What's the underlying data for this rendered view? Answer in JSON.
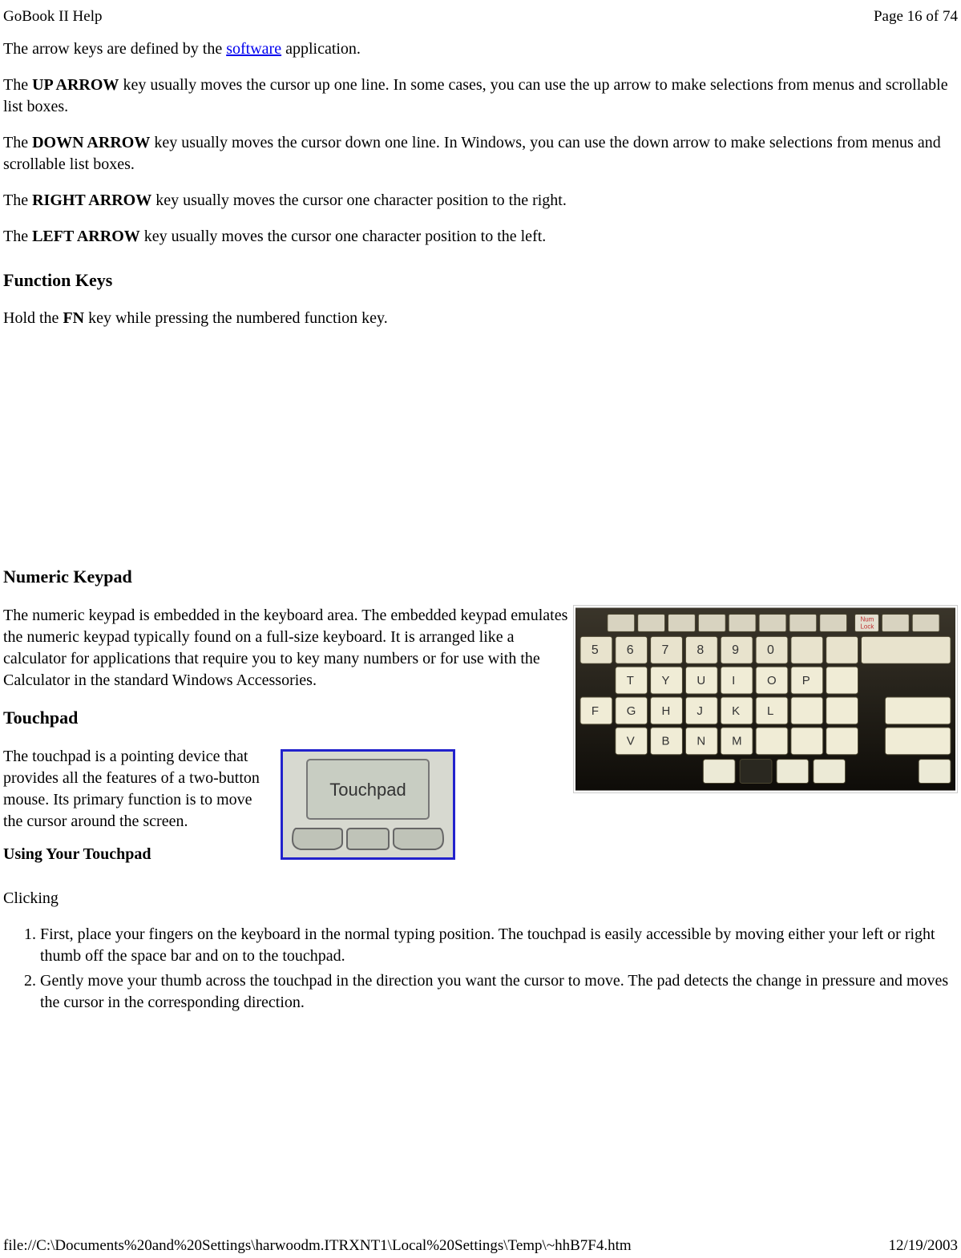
{
  "header": {
    "title": "GoBook II Help",
    "page_label": "Page 16 of 74"
  },
  "body": {
    "arrow_intro_pre": "The arrow keys are defined by the ",
    "software_link": "software",
    "arrow_intro_post": " application.",
    "up_arrow_label": "UP ARROW",
    "up_arrow_text_pre": "The ",
    "up_arrow_text_post": " key usually moves the cursor up one line. In some cases, you can use the up arrow to make selections from menus and scrollable list boxes.",
    "down_arrow_label": "DOWN ARROW",
    "down_arrow_text_pre": "The ",
    "down_arrow_text_post": " key usually moves the cursor down one line. In Windows, you can use the down arrow to make selections from menus and scrollable list boxes.",
    "right_arrow_label": "RIGHT ARROW",
    "right_arrow_text_pre": "The ",
    "right_arrow_text_post": " key usually moves the cursor one character position to the right.",
    "left_arrow_label": "LEFT ARROW",
    "left_arrow_text_pre": "The ",
    "left_arrow_text_post": " key usually moves the cursor one character position to the left.",
    "function_keys_heading": "Function Keys",
    "fn_text_pre": "Hold the ",
    "fn_label": "FN",
    "fn_text_post": " key while pressing the numbered function key.",
    "numeric_keypad_heading": "Numeric Keypad",
    "numeric_keypad_text": "The numeric keypad is embedded in the keyboard area.   The embedded keypad emulates the numeric keypad typically found on a full-size keyboard.   It is arranged like a calculator for applications that require you to key many numbers or for use with the Calculator in the standard Windows Accessories.",
    "touchpad_heading": "Touchpad",
    "touchpad_text": "The touchpad  is a pointing device that provides all the features of a two-button mouse. Its primary function is to move the cursor around the screen.",
    "touchpad_label_caption": "Touchpad",
    "using_touchpad_heading": "Using Your Touchpad",
    "clicking_label": "Clicking",
    "clicking_steps": [
      "First, place your fingers on the keyboard in the normal typing position. The touchpad is easily accessible by moving either your left or right thumb off the space bar and on to the touchpad.",
      "Gently move your thumb across the touchpad in the direction you want the cursor to move. The pad detects the change in pressure and moves the cursor in the corresponding direction."
    ]
  },
  "footer": {
    "path": "file://C:\\Documents%20and%20Settings\\harwoodm.ITRXNT1\\Local%20Settings\\Temp\\~hhB7F4.htm",
    "date": "12/19/2003"
  }
}
